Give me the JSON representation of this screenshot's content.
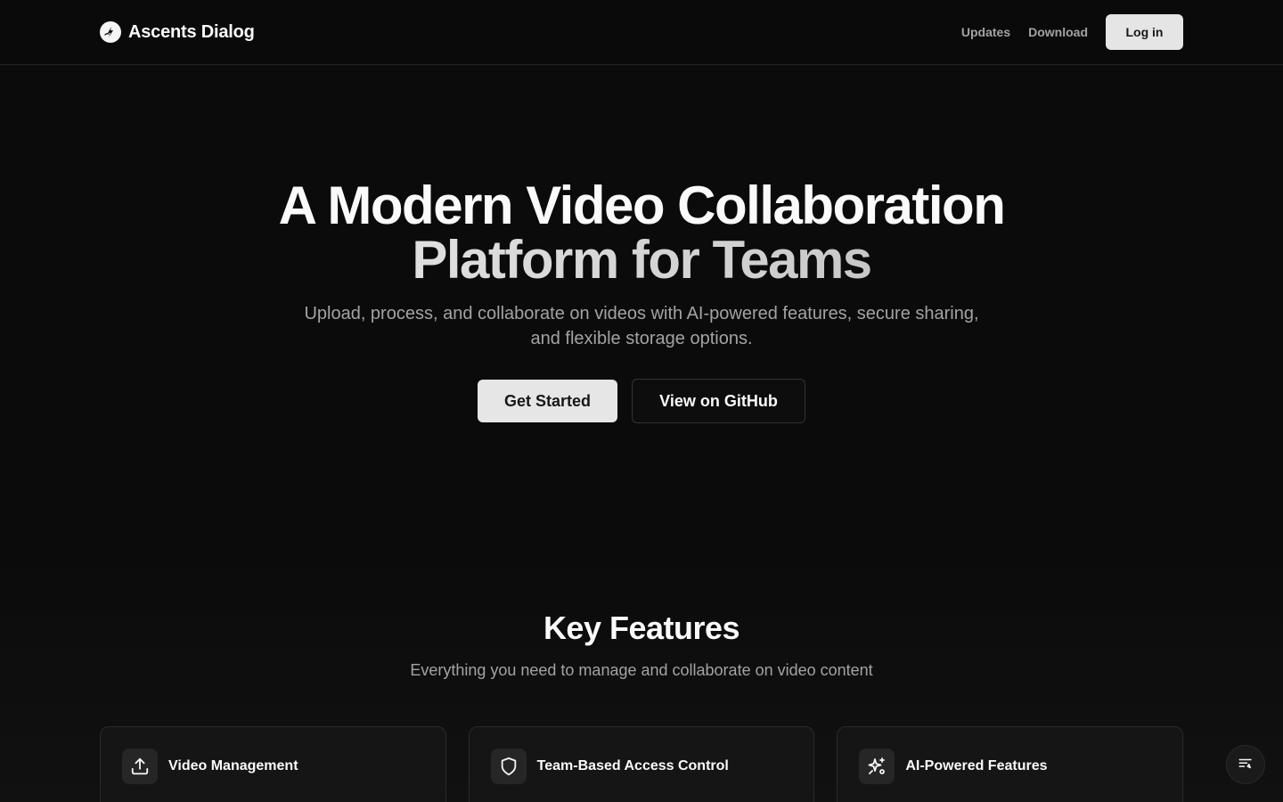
{
  "header": {
    "brand_name": "Ascents Dialog",
    "nav": [
      {
        "label": "Updates"
      },
      {
        "label": "Download"
      }
    ],
    "login_label": "Log in"
  },
  "hero": {
    "title_line1": "A Modern Video Collaboration",
    "title_line2": "Platform for Teams",
    "subtitle_line1": "Upload, process, and collaborate on videos with AI-powered features, secure sharing,",
    "subtitle_line2": "and flexible storage options.",
    "primary_cta": "Get Started",
    "secondary_cta": "View on GitHub"
  },
  "features": {
    "title": "Key Features",
    "subtitle": "Everything you need to manage and collaborate on video content",
    "cards": [
      {
        "title": "Video Management",
        "icon": "upload-icon"
      },
      {
        "title": "Team-Based Access Control",
        "icon": "shield-icon"
      },
      {
        "title": "AI-Powered Features",
        "icon": "sparkles-icon"
      }
    ]
  },
  "floating": {
    "icon": "list-filter-icon"
  },
  "colors": {
    "background": "#0b0b0b",
    "primary_button": "#e6e6e6",
    "muted_text": "#a3a3a3",
    "card_bg": "#151515"
  }
}
